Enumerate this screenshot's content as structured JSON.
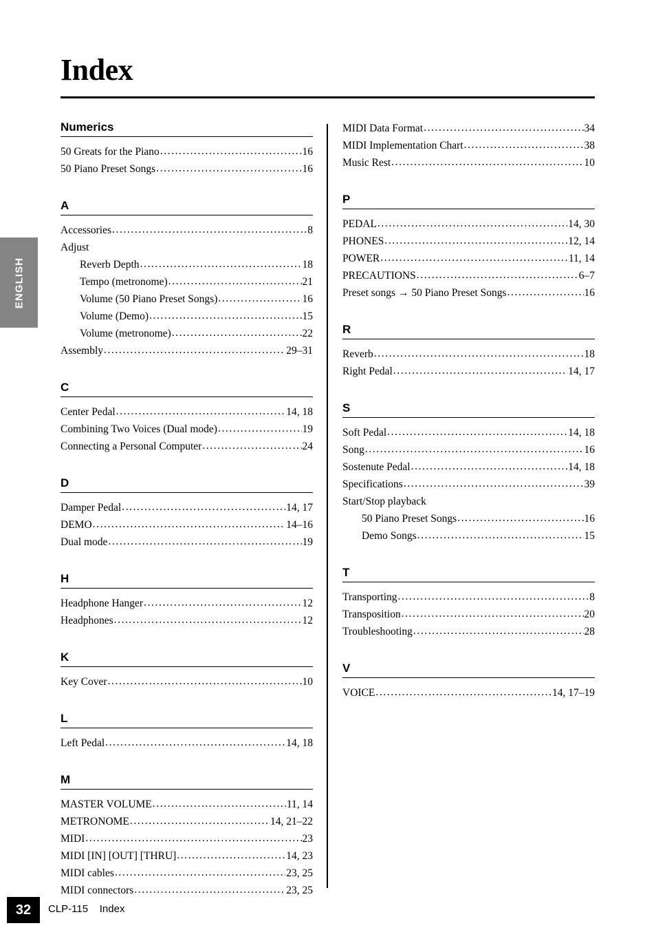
{
  "page": {
    "title": "Index",
    "language_tab": "ENGLISH",
    "footer": {
      "page_number": "32",
      "text": "CLP-115    Index"
    }
  },
  "columns": {
    "left": [
      {
        "heading": "Numerics",
        "entries": [
          {
            "label": "50 Greats for the Piano",
            "page": "16",
            "sub": false
          },
          {
            "label": "50 Piano Preset Songs",
            "page": "16",
            "sub": false
          }
        ]
      },
      {
        "heading": "A",
        "entries": [
          {
            "label": "Accessories",
            "page": "8",
            "sub": false
          },
          {
            "label": "Adjust",
            "page": "",
            "sub": false,
            "no_leader": true
          },
          {
            "label": "Reverb Depth",
            "page": "18",
            "sub": true
          },
          {
            "label": "Tempo (metronome)",
            "page": "21",
            "sub": true
          },
          {
            "label": "Volume (50 Piano Preset Songs)",
            "page": "16",
            "sub": true
          },
          {
            "label": "Volume (Demo)",
            "page": "15",
            "sub": true
          },
          {
            "label": "Volume (metronome)",
            "page": "22",
            "sub": true
          },
          {
            "label": "Assembly",
            "page": "29–31",
            "sub": false
          }
        ]
      },
      {
        "heading": "C",
        "entries": [
          {
            "label": "Center Pedal",
            "page": "14, 18",
            "sub": false
          },
          {
            "label": "Combining Two Voices (Dual mode)",
            "page": "19",
            "sub": false
          },
          {
            "label": "Connecting a Personal Computer",
            "page": "24",
            "sub": false
          }
        ]
      },
      {
        "heading": "D",
        "entries": [
          {
            "label": "Damper Pedal",
            "page": "14, 17",
            "sub": false
          },
          {
            "label": "DEMO",
            "page": "14–16",
            "sub": false
          },
          {
            "label": "Dual mode",
            "page": "19",
            "sub": false
          }
        ]
      },
      {
        "heading": "H",
        "entries": [
          {
            "label": "Headphone Hanger",
            "page": "12",
            "sub": false
          },
          {
            "label": "Headphones",
            "page": "12",
            "sub": false
          }
        ]
      },
      {
        "heading": "K",
        "entries": [
          {
            "label": "Key Cover",
            "page": "10",
            "sub": false
          }
        ]
      },
      {
        "heading": "L",
        "entries": [
          {
            "label": "Left Pedal",
            "page": "14, 18",
            "sub": false
          }
        ]
      },
      {
        "heading": "M",
        "entries": [
          {
            "label": "MASTER VOLUME",
            "page": "11, 14",
            "sub": false
          },
          {
            "label": "METRONOME",
            "page": "14, 21–22",
            "sub": false
          },
          {
            "label": "MIDI",
            "page": "23",
            "sub": false
          },
          {
            "label": "MIDI [IN] [OUT] [THRU]",
            "page": "14, 23",
            "sub": false
          },
          {
            "label": "MIDI cables",
            "page": "23, 25",
            "sub": false
          },
          {
            "label": "MIDI connectors",
            "page": "23, 25",
            "sub": false
          }
        ]
      }
    ],
    "right": [
      {
        "heading": "",
        "entries": [
          {
            "label": "MIDI Data Format",
            "page": "34",
            "sub": false
          },
          {
            "label": "MIDI Implementation Chart",
            "page": "38",
            "sub": false
          },
          {
            "label": "Music Rest",
            "page": "10",
            "sub": false
          }
        ]
      },
      {
        "heading": "P",
        "entries": [
          {
            "label": "PEDAL",
            "page": "14, 30",
            "sub": false
          },
          {
            "label": "PHONES",
            "page": "12, 14",
            "sub": false
          },
          {
            "label": "POWER",
            "page": "11, 14",
            "sub": false
          },
          {
            "label": "PRECAUTIONS",
            "page": "6–7",
            "sub": false
          },
          {
            "label": "Preset songs → 50 Piano Preset Songs",
            "page": "16",
            "sub": false
          }
        ]
      },
      {
        "heading": "R",
        "entries": [
          {
            "label": "Reverb",
            "page": "18",
            "sub": false
          },
          {
            "label": "Right Pedal",
            "page": "14, 17",
            "sub": false
          }
        ]
      },
      {
        "heading": "S",
        "entries": [
          {
            "label": "Soft Pedal",
            "page": "14, 18",
            "sub": false
          },
          {
            "label": "Song",
            "page": "16",
            "sub": false
          },
          {
            "label": "Sostenute Pedal",
            "page": "14, 18",
            "sub": false
          },
          {
            "label": "Specifications",
            "page": "39",
            "sub": false
          },
          {
            "label": "Start/Stop playback",
            "page": "",
            "sub": false,
            "no_leader": true
          },
          {
            "label": "50 Piano Preset Songs",
            "page": "16",
            "sub": true
          },
          {
            "label": "Demo Songs",
            "page": "15",
            "sub": true
          }
        ]
      },
      {
        "heading": "T",
        "entries": [
          {
            "label": "Transporting",
            "page": "8",
            "sub": false
          },
          {
            "label": "Transposition",
            "page": "20",
            "sub": false
          },
          {
            "label": "Troubleshooting",
            "page": "28",
            "sub": false
          }
        ]
      },
      {
        "heading": "V",
        "entries": [
          {
            "label": "VOICE",
            "page": "14, 17–19",
            "sub": false
          }
        ]
      }
    ]
  },
  "colors": {
    "language_tab_bg": "#848484",
    "footer_box_bg": "#000000",
    "text": "#000000",
    "page_bg": "#ffffff"
  }
}
